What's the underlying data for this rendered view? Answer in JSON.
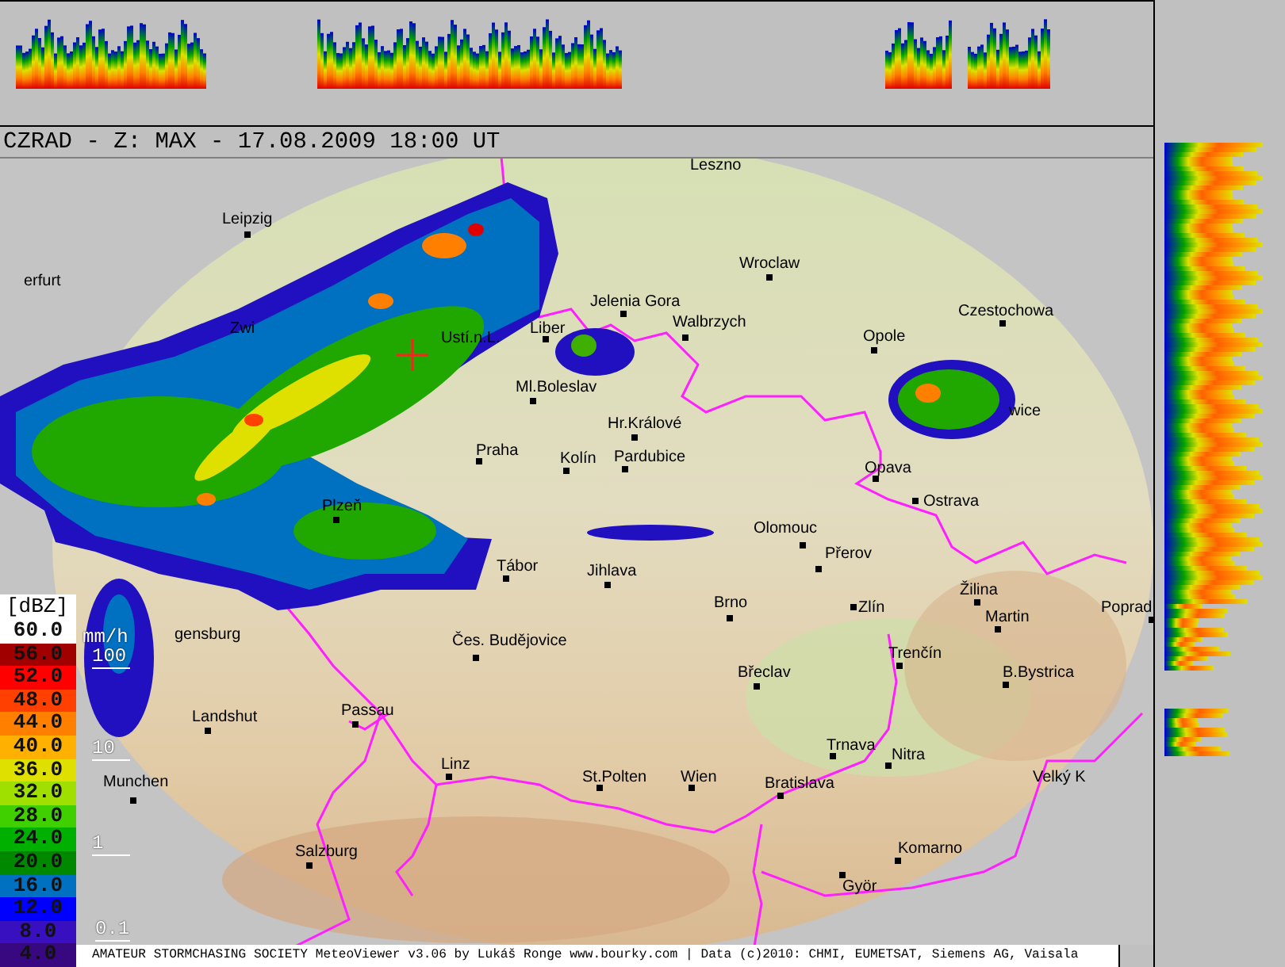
{
  "title": "CZRAD - Z: MAX - 17.08.2009 18:00 UT",
  "legend": {
    "unit": "[dBZ]",
    "items": [
      {
        "value": "60.0",
        "color": "#ffffff"
      },
      {
        "value": "56.0",
        "color": "#a00000"
      },
      {
        "value": "52.0",
        "color": "#ff0000"
      },
      {
        "value": "48.0",
        "color": "#ff4000"
      },
      {
        "value": "44.0",
        "color": "#ff8000"
      },
      {
        "value": "40.0",
        "color": "#ffb000"
      },
      {
        "value": "36.0",
        "color": "#e0e000"
      },
      {
        "value": "32.0",
        "color": "#a0e000"
      },
      {
        "value": "28.0",
        "color": "#40d000"
      },
      {
        "value": "24.0",
        "color": "#00b000"
      },
      {
        "value": "20.0",
        "color": "#008800"
      },
      {
        "value": "16.0",
        "color": "#0070c0"
      },
      {
        "value": "12.0",
        "color": "#0000ff"
      },
      {
        "value": "8.0",
        "color": "#3810c0"
      },
      {
        "value": "4.0",
        "color": "#380880"
      }
    ]
  },
  "rain_scale": {
    "unit": "mm/h",
    "ticks": [
      "100",
      "10",
      "1",
      "0.1"
    ]
  },
  "cities": [
    "Leszno",
    "Leipzig",
    "erfurt",
    "Zwi",
    "Wroclaw",
    "Jelenia Gora",
    "Liber",
    "Walbrzych",
    "Ustí.n.L.",
    "Ml.Boleslav",
    "Hr.Králové",
    "Praha",
    "Kolín",
    "Pardubice",
    "Opole",
    "Czestochowa",
    "wice",
    "Opava",
    "Ostrava",
    "Olomouc",
    "Přerov",
    "Plzeň",
    "Tábor",
    "Jihlava",
    "Brno",
    "Zlín",
    "Žilina",
    "Martin",
    "Poprad",
    "Trenčín",
    "B.Bystrica",
    "Břeclav",
    "gensburg",
    "Čes. Budějovice",
    "Landshut",
    "Passau",
    "Trnava",
    "Nitra",
    "Linz",
    "Munchen",
    "St.Polten",
    "Wien",
    "Bratislava",
    "Velký K",
    "Komarno",
    "Salzburg",
    "Györ"
  ],
  "footer": "AMATEUR STORMCHASING SOCIETY MeteoViewer v3.06 by Lukáš Ronge www.bourky.com | Data (c)2010: CHMI, EUMETSAT, Siemens AG, Vaisala"
}
